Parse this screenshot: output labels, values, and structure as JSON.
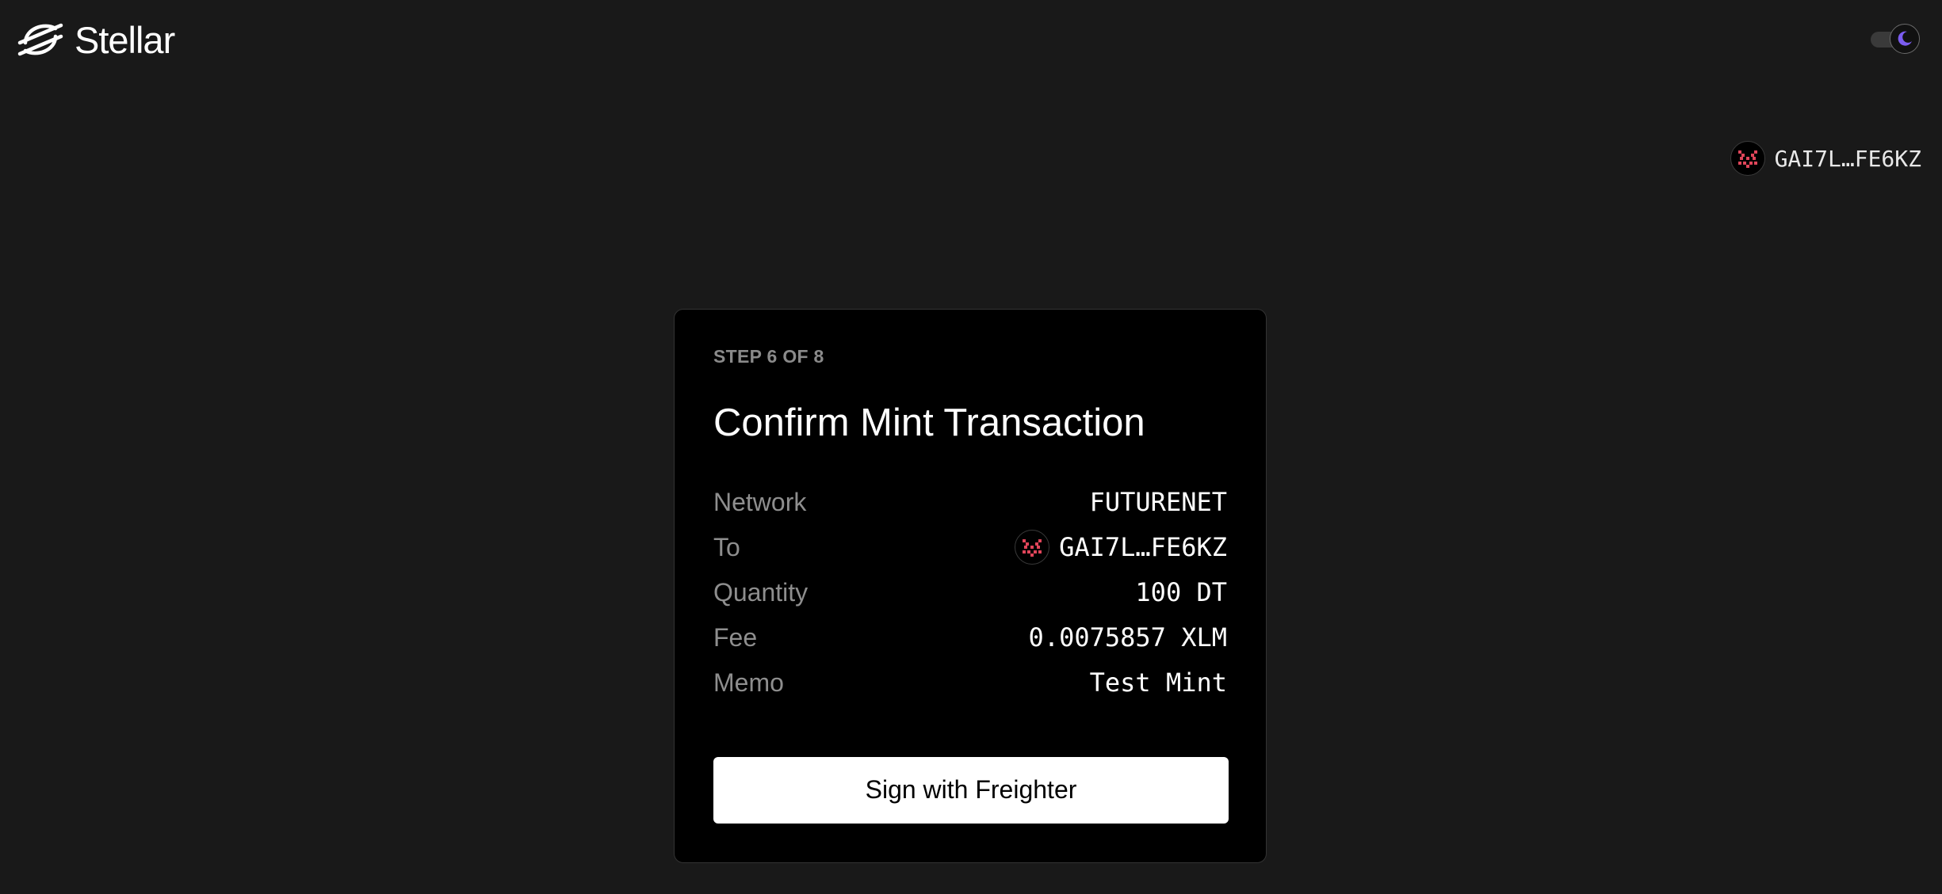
{
  "header": {
    "brand": "Stellar",
    "logo_icon": "stellar-logo-icon",
    "theme_toggle_icon": "moon-icon",
    "theme": "dark"
  },
  "account": {
    "address_short": "GAI7L…FE6KZ",
    "identicon_color": "#e0455a"
  },
  "card": {
    "step_label": "STEP 6 OF 8",
    "title": "Confirm Mint Transaction",
    "details": [
      {
        "label": "Network",
        "value": "FUTURENET"
      },
      {
        "label": "To",
        "value": "GAI7L…FE6KZ"
      },
      {
        "label": "Quantity",
        "value": "100 DT"
      },
      {
        "label": "Fee",
        "value": "0.0075857 XLM"
      },
      {
        "label": "Memo",
        "value": "Test Mint"
      }
    ],
    "sign_button_label": "Sign with Freighter"
  },
  "colors": {
    "background": "#191919",
    "card_background": "#000000",
    "toggle_accent": "#7b5cf0",
    "identicon_accent": "#e0455a"
  }
}
